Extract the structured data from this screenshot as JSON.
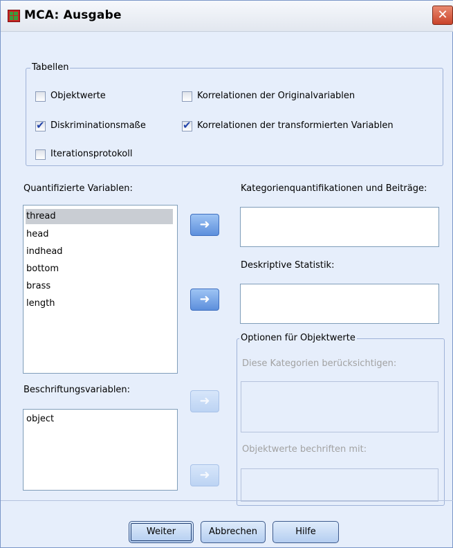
{
  "window": {
    "title": "MCA: Ausgabe",
    "close_glyph": "✕"
  },
  "tables_group": {
    "legend": "Tabellen",
    "checkboxes": [
      {
        "label": "Objektwerte",
        "checked": false
      },
      {
        "label": "Diskriminationsmaße",
        "checked": true
      },
      {
        "label": "Iterationsprotokoll",
        "checked": false
      },
      {
        "label": "Korrelationen der Originalvariablen",
        "checked": false
      },
      {
        "label": "Korrelationen der transformierten Variablen",
        "checked": true
      }
    ]
  },
  "quantified": {
    "label": "Quantifizierte Variablen:",
    "items": [
      "thread",
      "head",
      "indhead",
      "bottom",
      "brass",
      "length"
    ],
    "selected": "thread"
  },
  "category_quant": {
    "label": "Kategorienquantifikationen und Beiträge:"
  },
  "descriptive": {
    "label": "Deskriptive Statistik:"
  },
  "labeling": {
    "label": "Beschriftungsvariablen:",
    "items": [
      "object"
    ]
  },
  "object_options": {
    "legend": "Optionen für Objektwerte",
    "include_label": "Diese Kategorien berücksichtigen:",
    "label_by_label": "Objektwerte bechriften mit:"
  },
  "buttons": {
    "continue": "Weiter",
    "cancel": "Abbrechen",
    "help": "Hilfe"
  },
  "arrow_glyph": "➜",
  "colors": {
    "window_bg": "#e6eefb",
    "accent": "#5d8fdc",
    "selection": "#c9cdd3",
    "close": "#c9432a"
  }
}
